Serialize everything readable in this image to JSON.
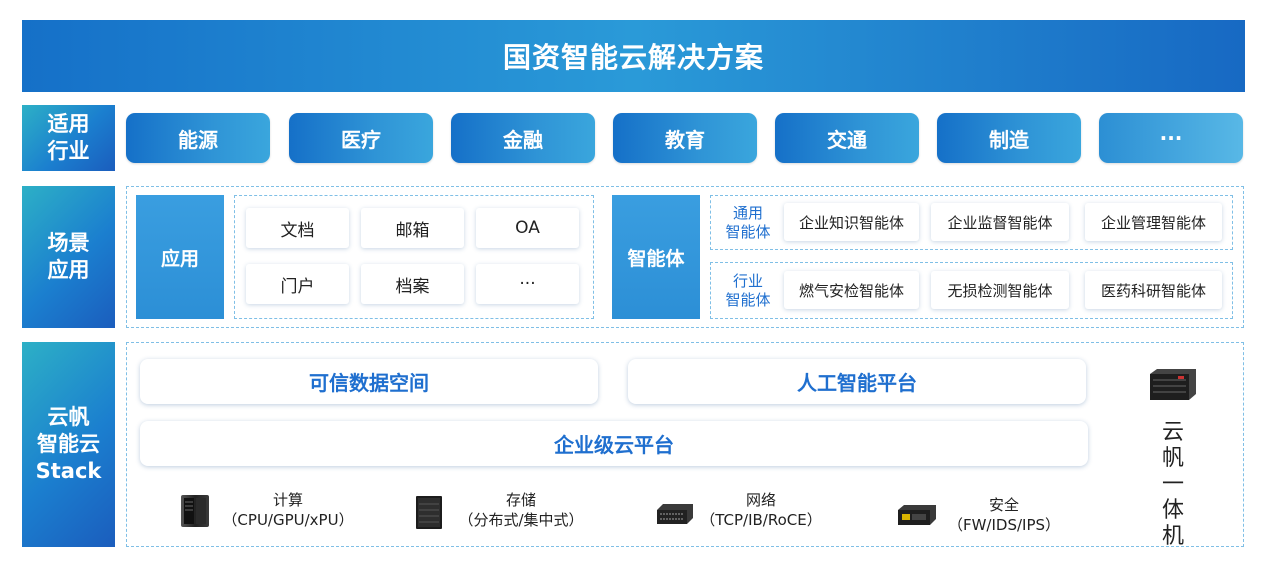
{
  "title": "国资智能云解决方案",
  "rows": {
    "industry": "适用\n行业",
    "scenario": "场景\n应用",
    "stack": "云帆\n智能云\nStack"
  },
  "industries": [
    "能源",
    "医疗",
    "金融",
    "教育",
    "交通",
    "制造",
    "···"
  ],
  "applications": {
    "label": "应用",
    "items": [
      "文档",
      "邮箱",
      "OA",
      "门户",
      "档案",
      "···"
    ]
  },
  "agents": {
    "label": "智能体",
    "general": {
      "label": "通用\n智能体",
      "items": [
        "企业知识智能体",
        "企业监督智能体",
        "企业管理智能体"
      ]
    },
    "industry": {
      "label": "行业\n智能体",
      "items": [
        "燃气安检智能体",
        "无损检测智能体",
        "医药科研智能体"
      ]
    }
  },
  "stack": {
    "trusted_data_space": "可信数据空间",
    "ai_platform": "人工智能平台",
    "enterprise_cloud": "企业级云平台",
    "hardware": [
      {
        "name": "计算",
        "detail": "（CPU/GPU/xPU）",
        "icon": "server-tower-icon"
      },
      {
        "name": "存储",
        "detail": "（分布式/集中式）",
        "icon": "storage-cabinet-icon"
      },
      {
        "name": "网络",
        "detail": "（TCP/IB/RoCE）",
        "icon": "network-switch-icon"
      },
      {
        "name": "安全",
        "detail": "（FW/IDS/IPS）",
        "icon": "firewall-appliance-icon"
      }
    ],
    "all_in_one": [
      "云",
      "帆",
      "一",
      "体",
      "机"
    ]
  },
  "colors": {
    "primary": "#1570c8",
    "accent": "#2c8fd6",
    "text_blue": "#1f6fcf",
    "dashed_border": "#7fbfe6"
  }
}
